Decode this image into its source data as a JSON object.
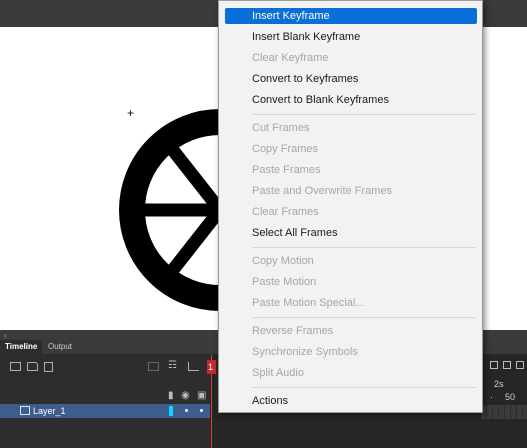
{
  "stage": {
    "crosshair_symbol": "+"
  },
  "timeline": {
    "tabs": [
      "Timeline",
      "Output"
    ],
    "layer": {
      "name": "Layer_1",
      "color": "#10d6ff"
    },
    "playhead_frame": "1",
    "ruler": {
      "time_label": "2s",
      "frame_label": "50"
    }
  },
  "context_menu": {
    "groups": [
      [
        {
          "label": "Insert Keyframe",
          "enabled": true,
          "highlighted": true
        },
        {
          "label": "Insert Blank Keyframe",
          "enabled": true
        },
        {
          "label": "Clear Keyframe",
          "enabled": false
        },
        {
          "label": "Convert to Keyframes",
          "enabled": true
        },
        {
          "label": "Convert to Blank Keyframes",
          "enabled": true
        }
      ],
      [
        {
          "label": "Cut Frames",
          "enabled": false
        },
        {
          "label": "Copy Frames",
          "enabled": false
        },
        {
          "label": "Paste Frames",
          "enabled": false
        },
        {
          "label": "Paste and Overwrite Frames",
          "enabled": false
        },
        {
          "label": "Clear Frames",
          "enabled": false
        },
        {
          "label": "Select All Frames",
          "enabled": true
        }
      ],
      [
        {
          "label": "Copy Motion",
          "enabled": false
        },
        {
          "label": "Paste Motion",
          "enabled": false
        },
        {
          "label": "Paste Motion Special...",
          "enabled": false
        }
      ],
      [
        {
          "label": "Reverse Frames",
          "enabled": false
        },
        {
          "label": "Synchronize Symbols",
          "enabled": false
        },
        {
          "label": "Split Audio",
          "enabled": false
        }
      ],
      [
        {
          "label": "Actions",
          "enabled": true
        }
      ]
    ]
  },
  "colors": {
    "highlight": "#0a6fd6",
    "layer_row": "#3d5e8d",
    "playhead": "#e23a3a"
  }
}
